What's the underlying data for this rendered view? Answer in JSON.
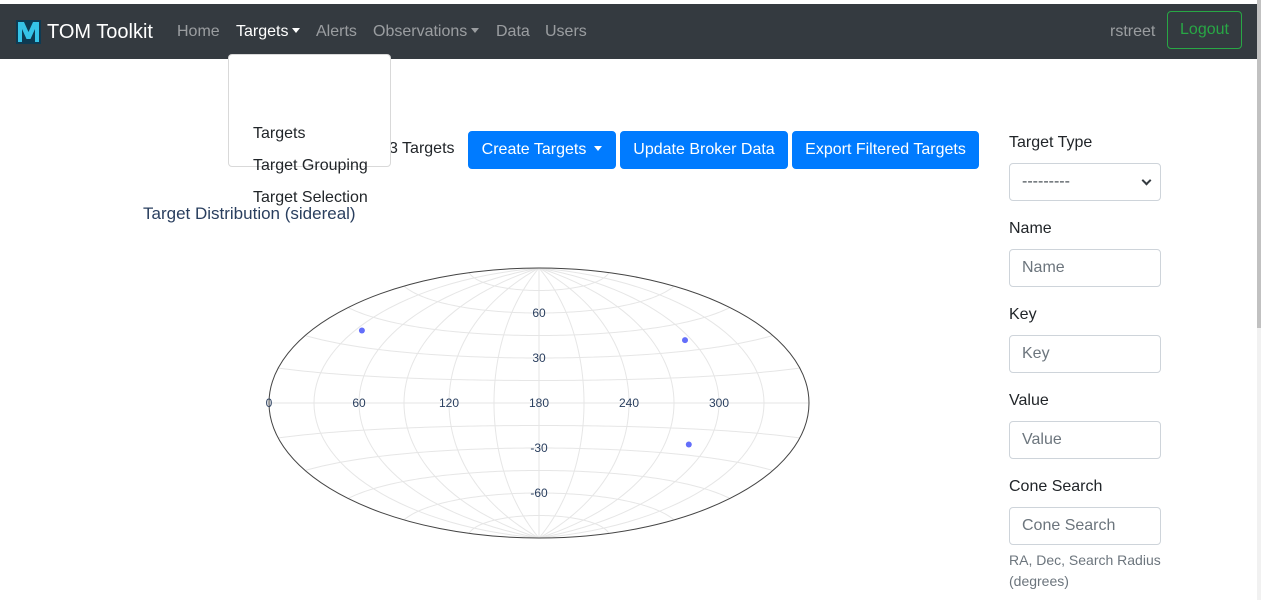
{
  "navbar": {
    "brand": "TOM Toolkit",
    "links": {
      "home": "Home",
      "targets": "Targets",
      "alerts": "Alerts",
      "observations": "Observations",
      "data": "Data",
      "users": "Users"
    },
    "username": "rstreet",
    "logout_label": "Logout"
  },
  "targets_dropdown": {
    "items": [
      "Targets",
      "Target Grouping",
      "Target Selection"
    ]
  },
  "toolbar": {
    "count_text": "3 Targets",
    "create_label": "Create Targets",
    "update_label": "Update Broker Data",
    "export_label": "Export Filtered Targets"
  },
  "chart_data": {
    "type": "scatter",
    "title": "Target Distribution (sidereal)",
    "projection": "aitoff",
    "x_tick_labels": [
      "0",
      "60",
      "120",
      "180",
      "240",
      "300"
    ],
    "y_tick_labels": [
      "60",
      "30",
      "-30",
      "-60"
    ],
    "grid": true,
    "series": [
      {
        "points": [
          {
            "ra": 35,
            "dec": 38
          },
          {
            "ra": 295,
            "dec": 36
          },
          {
            "ra": 287,
            "dec": -24
          }
        ],
        "color": "#636efa"
      }
    ]
  },
  "filters": {
    "target_type_label": "Target Type",
    "target_type_value": "---------",
    "name_label": "Name",
    "name_placeholder": "Name",
    "key_label": "Key",
    "key_placeholder": "Key",
    "value_label": "Value",
    "value_placeholder": "Value",
    "cone_label": "Cone Search",
    "cone_placeholder": "Cone Search",
    "cone_help": "RA, Dec, Search Radius (degrees)"
  },
  "colors": {
    "navbar_bg": "#343a40",
    "primary": "#007bff",
    "success": "#28a745",
    "marker": "#636efa",
    "axis_text": "#2a3f5f"
  }
}
